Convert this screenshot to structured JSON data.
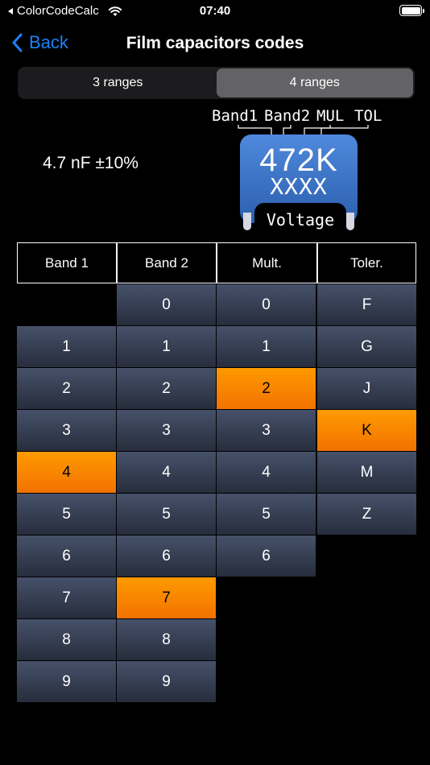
{
  "status_bar": {
    "app": "ColorCodeCalc",
    "time": "07:40"
  },
  "nav": {
    "back": "Back",
    "title": "Film capacitors codes"
  },
  "segments": [
    {
      "label": "3 ranges",
      "active": false
    },
    {
      "label": "4 ranges",
      "active": true
    }
  ],
  "value": "4.7 nF ±10%",
  "diagram": {
    "band_labels": [
      "Band1",
      "Band2",
      "MUL",
      "TOL"
    ],
    "code": "472K",
    "xxxx": "XXXX",
    "voltage": "Voltage"
  },
  "columns": [
    {
      "header": "Band 1",
      "values": [
        "1",
        "2",
        "3",
        "4",
        "5",
        "6",
        "7",
        "8",
        "9"
      ],
      "start_row": 1,
      "selected": "4"
    },
    {
      "header": "Band 2",
      "values": [
        "0",
        "1",
        "2",
        "3",
        "4",
        "5",
        "6",
        "7",
        "8",
        "9"
      ],
      "start_row": 0,
      "selected": "7"
    },
    {
      "header": "Mult.",
      "values": [
        "0",
        "1",
        "2",
        "3",
        "4",
        "5",
        "6"
      ],
      "start_row": 0,
      "selected": "2"
    },
    {
      "header": "Toler.",
      "values": [
        "F",
        "G",
        "J",
        "K",
        "M",
        "Z"
      ],
      "start_row": 0,
      "selected": "K"
    }
  ],
  "colors": {
    "accent_blue": "#1a82f7",
    "selected_orange": "#ff8c00",
    "cell_dark": "#343c4f"
  }
}
